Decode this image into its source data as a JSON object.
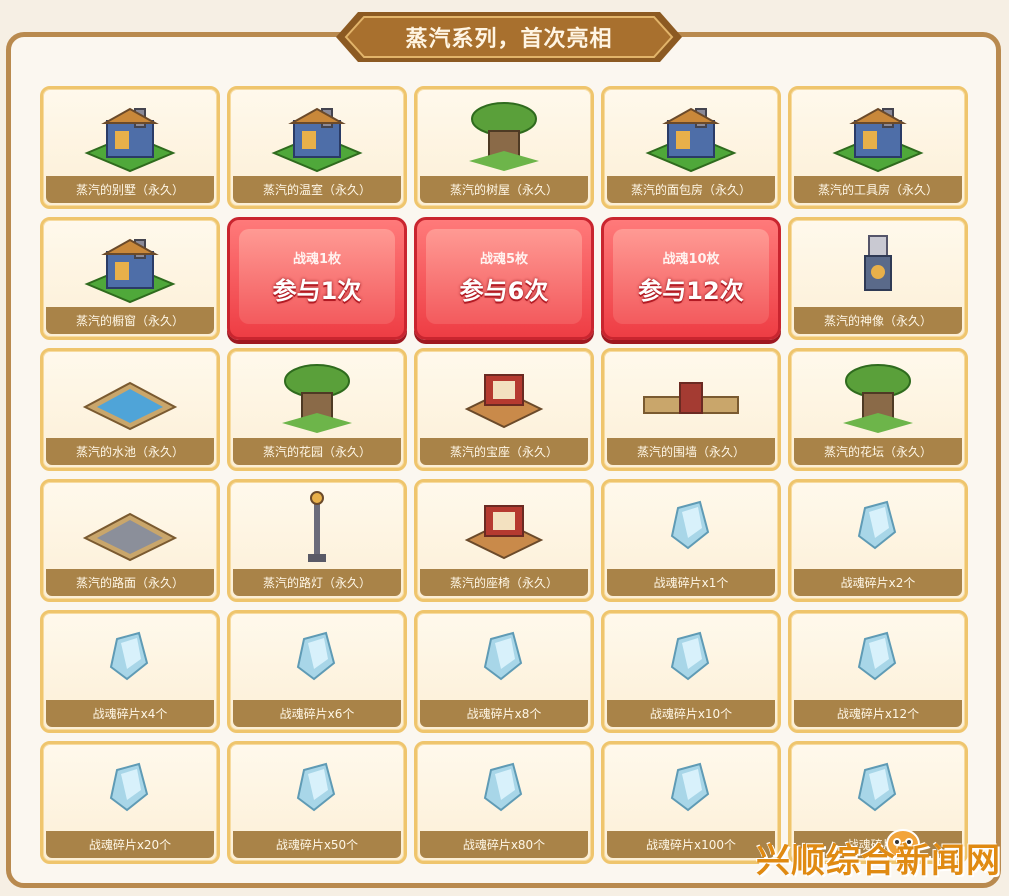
{
  "banner": {
    "title": "蒸汽系列，首次亮相"
  },
  "rows": [
    [
      {
        "type": "item",
        "icon": "steam-villa-icon",
        "label": "蒸汽的别墅（永久）"
      },
      {
        "type": "item",
        "icon": "steam-greenhouse-icon",
        "label": "蒸汽的温室（永久）"
      },
      {
        "type": "item",
        "icon": "steam-treehouse-icon",
        "label": "蒸汽的树屋（永久）"
      },
      {
        "type": "item",
        "icon": "steam-bakery-icon",
        "label": "蒸汽的面包房（永久）"
      },
      {
        "type": "item",
        "icon": "steam-workshop-icon",
        "label": "蒸汽的工具房（永久）"
      }
    ],
    [
      {
        "type": "item",
        "icon": "steam-showcase-icon",
        "label": "蒸汽的橱窗（永久）"
      },
      {
        "type": "draw",
        "cost": "战魂1枚",
        "times": "参与1次"
      },
      {
        "type": "draw",
        "cost": "战魂5枚",
        "times": "参与6次"
      },
      {
        "type": "draw",
        "cost": "战魂10枚",
        "times": "参与12次"
      },
      {
        "type": "item",
        "icon": "steam-statue-icon",
        "label": "蒸汽的神像（永久）"
      }
    ],
    [
      {
        "type": "item",
        "icon": "steam-pool-icon",
        "label": "蒸汽的水池（永久）"
      },
      {
        "type": "item",
        "icon": "steam-garden-icon",
        "label": "蒸汽的花园（永久）"
      },
      {
        "type": "item",
        "icon": "steam-throne-icon",
        "label": "蒸汽的宝座（永久）"
      },
      {
        "type": "item",
        "icon": "steam-fence-icon",
        "label": "蒸汽的围墙（永久）"
      },
      {
        "type": "item",
        "icon": "steam-flowerbed-icon",
        "label": "蒸汽的花坛（永久）"
      }
    ],
    [
      {
        "type": "item",
        "icon": "steam-pavement-icon",
        "label": "蒸汽的路面（永久）"
      },
      {
        "type": "item",
        "icon": "steam-streetlamp-icon",
        "label": "蒸汽的路灯（永久）"
      },
      {
        "type": "item",
        "icon": "steam-bench-icon",
        "label": "蒸汽的座椅（永久）"
      },
      {
        "type": "item",
        "icon": "crystal-shard-icon",
        "label": "战魂碎片x1个"
      },
      {
        "type": "item",
        "icon": "crystal-shard-icon",
        "label": "战魂碎片x2个"
      }
    ],
    [
      {
        "type": "item",
        "icon": "crystal-shard-icon",
        "label": "战魂碎片x4个"
      },
      {
        "type": "item",
        "icon": "crystal-shard-icon",
        "label": "战魂碎片x6个"
      },
      {
        "type": "item",
        "icon": "crystal-shard-icon",
        "label": "战魂碎片x8个"
      },
      {
        "type": "item",
        "icon": "crystal-shard-icon",
        "label": "战魂碎片x10个"
      },
      {
        "type": "item",
        "icon": "crystal-shard-icon",
        "label": "战魂碎片x12个"
      }
    ],
    [
      {
        "type": "item",
        "icon": "crystal-shard-icon",
        "label": "战魂碎片x20个"
      },
      {
        "type": "item",
        "icon": "crystal-shard-icon",
        "label": "战魂碎片x50个"
      },
      {
        "type": "item",
        "icon": "crystal-shard-icon",
        "label": "战魂碎片x80个"
      },
      {
        "type": "item",
        "icon": "crystal-shard-icon",
        "label": "战魂碎片x100个"
      },
      {
        "type": "item",
        "icon": "crystal-shard-icon",
        "label": "战魂碎片x1"
      }
    ]
  ],
  "watermark": {
    "text": "兴顺综合新闻网"
  },
  "colors": {
    "frame": "#b98a4f",
    "label_bg": "#a98348",
    "card_border": "#efc56d",
    "draw_red": "#ee3d44"
  }
}
